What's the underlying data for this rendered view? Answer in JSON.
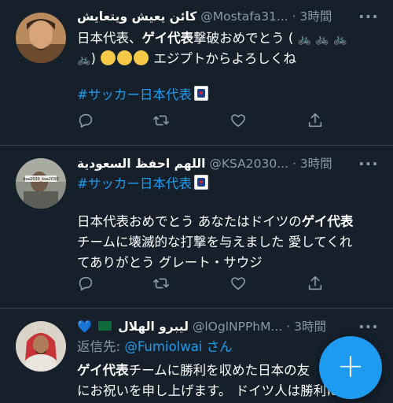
{
  "tweets": [
    {
      "name": "كائن يعيش ويتعايش",
      "handle": "@Mostafa31...",
      "dot": "·",
      "time": "3時間",
      "line1_pre": "日本代表、",
      "line1_bold": "ゲイ代表",
      "line1_post": "撃破おめでとう (",
      "bike": "🚲",
      "line2_pre": ")",
      "line2_post": " エジプトからよろしくね",
      "hashtag": "#サッカー日本代表"
    },
    {
      "name": "اللهم احفظ السعودية",
      "handle": "@KSA2030...",
      "dot": "·",
      "time": "3時間",
      "hashtag": "#サッカー日本代表",
      "avatar_text": "ksa2030_ksa2030",
      "line1_pre": "日本代表おめでとう あなたはドイツの",
      "line1_bold": "ゲイ代表",
      "line2": "チームに壊滅的な打撃を与えました 愛してくれ",
      "line3": "てありがとう グレート・サウジ"
    },
    {
      "heart": "💙",
      "name": "ليبرو الهلال",
      "handle": "@lOglNPPhM...",
      "dot": "·",
      "time": "3時間",
      "reply_label": "返信先: ",
      "reply_to": "@Fumiolwai",
      "reply_suffix": " さん",
      "line1_bold": "ゲイ代表",
      "line1_post": "チームに勝利を収めた日本の友",
      "line2": "にお祝いを申し上げます。 ドイツ人は勝利に値"
    }
  ],
  "more_glyph": "···",
  "fab_label": "+"
}
